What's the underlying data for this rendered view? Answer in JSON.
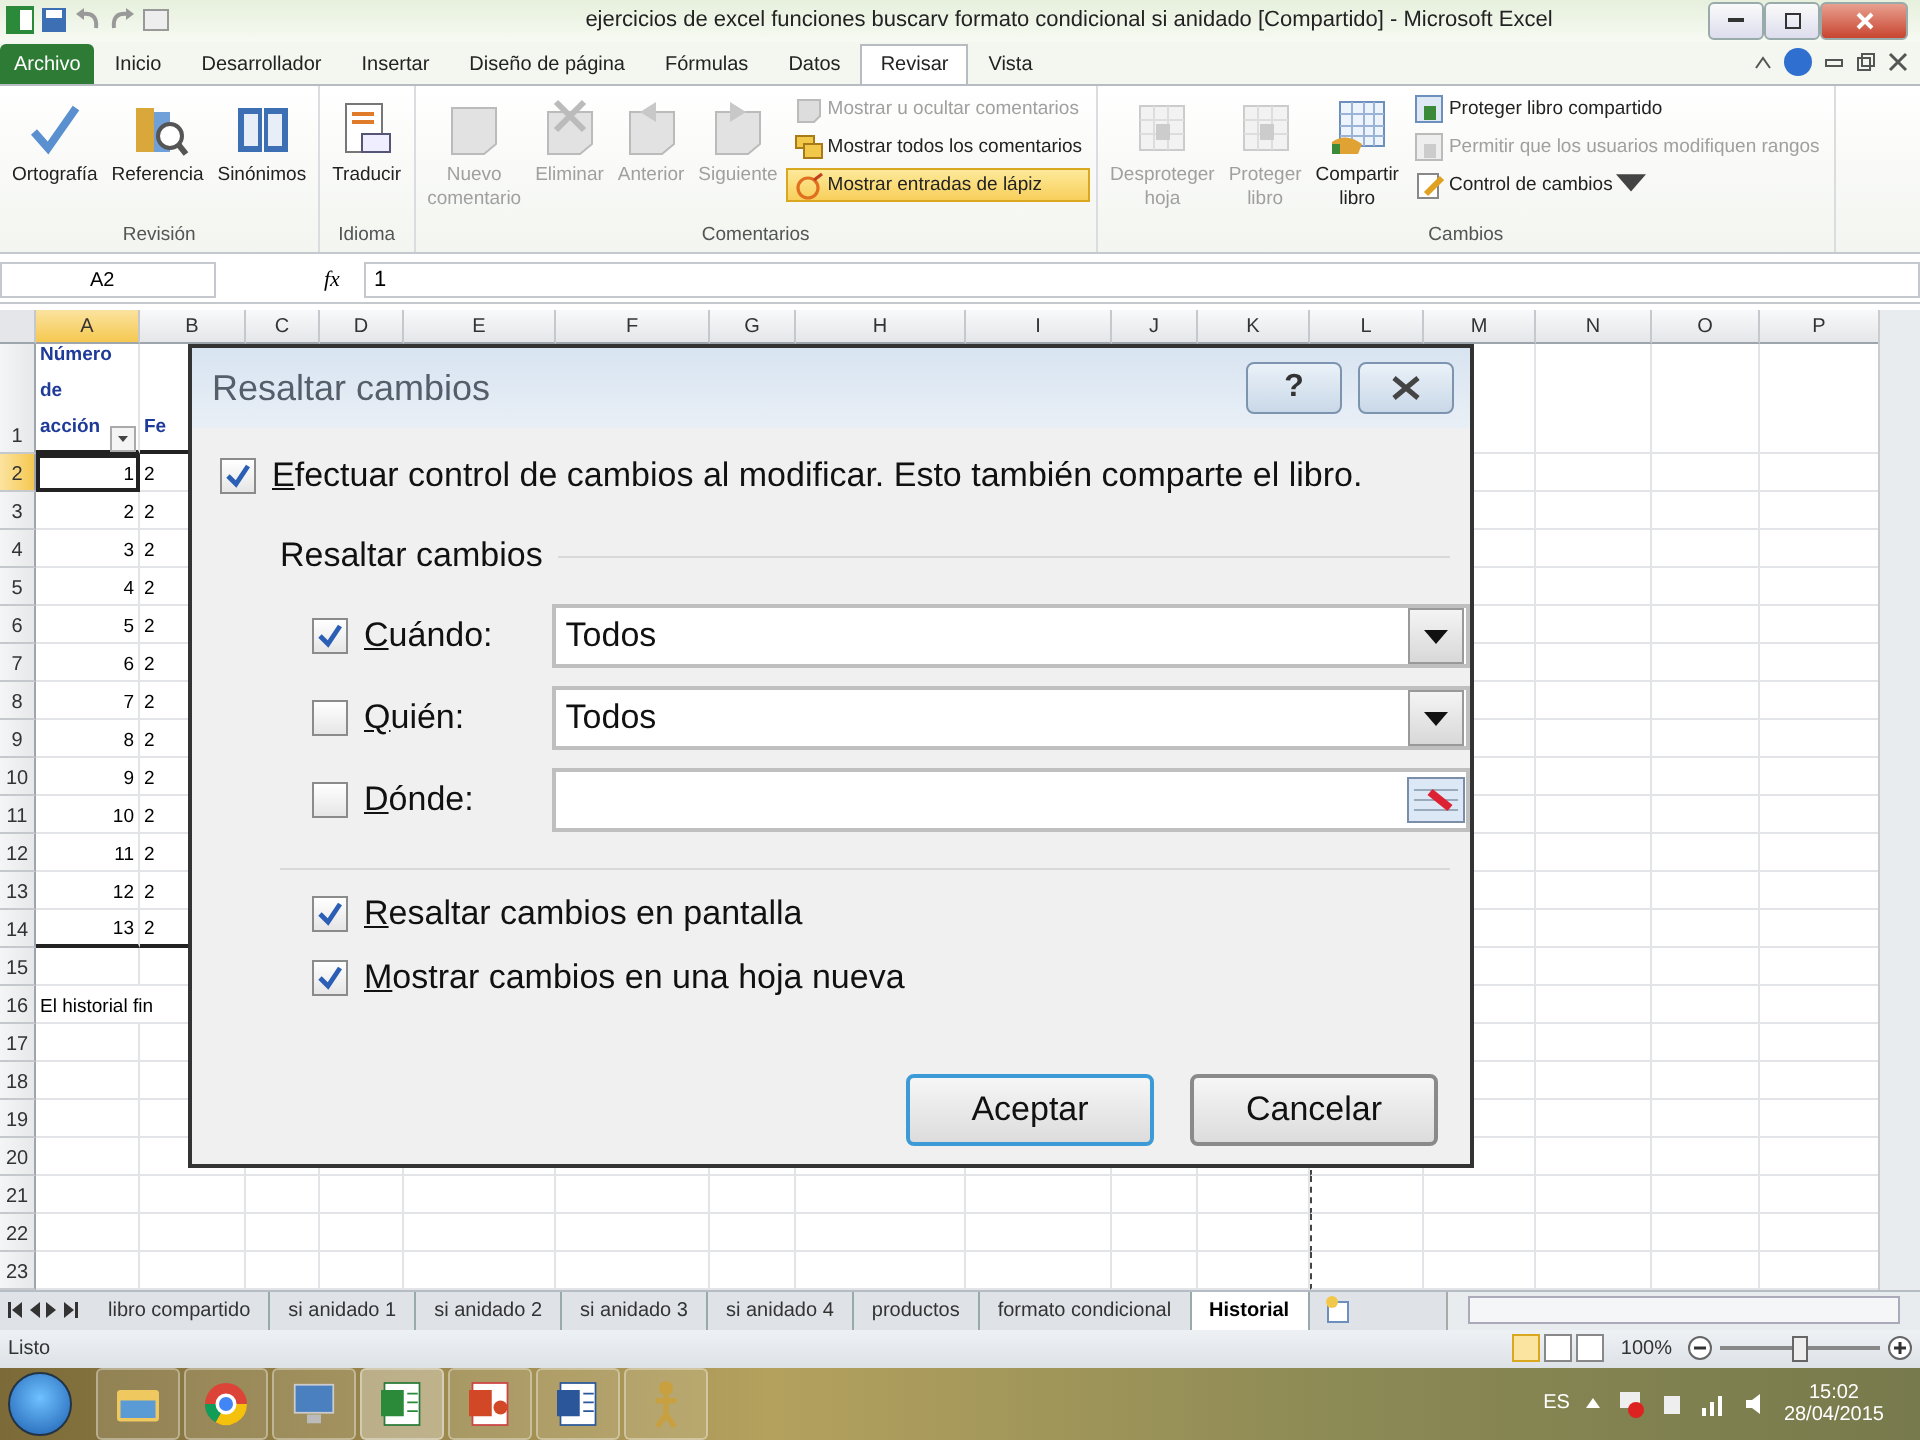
{
  "window": {
    "title": "ejercicios de excel funciones buscarv formato condicional si anidado  [Compartido]  -  Microsoft Excel"
  },
  "tabs": [
    {
      "label": "Archivo",
      "kind": "file",
      "selected": false
    },
    {
      "label": "Inicio",
      "kind": "tab",
      "selected": false
    },
    {
      "label": "Desarrollador",
      "kind": "tab",
      "selected": false
    },
    {
      "label": "Insertar",
      "kind": "tab",
      "selected": false
    },
    {
      "label": "Diseño de página",
      "kind": "tab",
      "selected": false
    },
    {
      "label": "Fórmulas",
      "kind": "tab",
      "selected": false
    },
    {
      "label": "Datos",
      "kind": "tab",
      "selected": false
    },
    {
      "label": "Revisar",
      "kind": "tab",
      "selected": true
    },
    {
      "label": "Vista",
      "kind": "tab",
      "selected": false
    }
  ],
  "ribbon": {
    "groups": [
      {
        "label": "Revisión",
        "items": [
          {
            "kind": "large",
            "label": "Ortografía",
            "disabled": false,
            "on": false
          },
          {
            "kind": "large",
            "label": "Referencia",
            "disabled": false,
            "on": false
          },
          {
            "kind": "large",
            "label": "Sinónimos",
            "disabled": false,
            "on": false
          }
        ]
      },
      {
        "label": "Idioma",
        "items": [
          {
            "kind": "large",
            "label": "Traducir",
            "disabled": false,
            "on": false
          }
        ]
      },
      {
        "label": "Comentarios",
        "items": [
          {
            "kind": "large",
            "label": "Nuevo comentario",
            "disabled": true,
            "on": false
          },
          {
            "kind": "large",
            "label": "Eliminar",
            "disabled": true,
            "on": false
          },
          {
            "kind": "large",
            "label": "Anterior",
            "disabled": true,
            "on": false
          },
          {
            "kind": "large",
            "label": "Siguiente",
            "disabled": true,
            "on": false
          },
          {
            "kind": "small",
            "label": "Mostrar u ocultar comentarios",
            "disabled": true,
            "on": false
          },
          {
            "kind": "small",
            "label": "Mostrar todos los comentarios",
            "disabled": false,
            "on": false
          },
          {
            "kind": "small",
            "label": "Mostrar entradas de lápiz",
            "disabled": false,
            "on": true
          }
        ]
      },
      {
        "label": "Cambios",
        "items": [
          {
            "kind": "large",
            "label": "Desproteger hoja",
            "disabled": true,
            "on": false
          },
          {
            "kind": "large",
            "label": "Proteger libro",
            "disabled": true,
            "on": false
          },
          {
            "kind": "large",
            "label": "Compartir libro",
            "disabled": false,
            "on": false
          },
          {
            "kind": "small",
            "label": "Proteger libro compartido",
            "disabled": false,
            "on": false
          },
          {
            "kind": "small",
            "label": "Permitir que los usuarios modifiquen rangos",
            "disabled": true,
            "on": false
          },
          {
            "kind": "menu",
            "label": "Control de cambios",
            "disabled": false,
            "on": false
          }
        ]
      }
    ]
  },
  "formula_bar": {
    "name_box": "A2",
    "function_label": "fx",
    "formula": "1"
  },
  "sheet": {
    "columns": [
      {
        "label": "A",
        "selected": true
      },
      {
        "label": "B",
        "selected": false
      },
      {
        "label": "C",
        "selected": false
      },
      {
        "label": "D",
        "selected": false
      },
      {
        "label": "E",
        "selected": false
      },
      {
        "label": "F",
        "selected": false
      },
      {
        "label": "G",
        "selected": false
      },
      {
        "label": "H",
        "selected": false
      },
      {
        "label": "I",
        "selected": false
      },
      {
        "label": "J",
        "selected": false
      },
      {
        "label": "K",
        "selected": false
      },
      {
        "label": "L",
        "selected": false
      },
      {
        "label": "M",
        "selected": false
      },
      {
        "label": "N",
        "selected": false
      },
      {
        "label": "O",
        "selected": false
      },
      {
        "label": "P",
        "selected": false
      }
    ],
    "rows": [
      {
        "header": "1",
        "kind": "header",
        "selected": false,
        "cells": [
          {
            "text": "Número de acción",
            "filter": true
          },
          {
            "text": "Fe"
          }
        ]
      },
      {
        "header": "2",
        "kind": "data",
        "selected": true,
        "cells": [
          {
            "text": "1"
          },
          {
            "text": "2"
          }
        ]
      },
      {
        "header": "3",
        "kind": "data",
        "selected": false,
        "cells": [
          {
            "text": "2"
          },
          {
            "text": "2"
          }
        ]
      },
      {
        "header": "4",
        "kind": "data",
        "selected": false,
        "cells": [
          {
            "text": "3"
          },
          {
            "text": "2"
          }
        ]
      },
      {
        "header": "5",
        "kind": "data",
        "selected": false,
        "cells": [
          {
            "text": "4"
          },
          {
            "text": "2"
          }
        ]
      },
      {
        "header": "6",
        "kind": "data",
        "selected": false,
        "cells": [
          {
            "text": "5"
          },
          {
            "text": "2"
          }
        ]
      },
      {
        "header": "7",
        "kind": "data",
        "selected": false,
        "cells": [
          {
            "text": "6"
          },
          {
            "text": "2"
          }
        ]
      },
      {
        "header": "8",
        "kind": "data",
        "selected": false,
        "cells": [
          {
            "text": "7"
          },
          {
            "text": "2"
          }
        ]
      },
      {
        "header": "9",
        "kind": "data",
        "selected": false,
        "cells": [
          {
            "text": "8"
          },
          {
            "text": "2"
          }
        ]
      },
      {
        "header": "10",
        "kind": "data",
        "selected": false,
        "cells": [
          {
            "text": "9"
          },
          {
            "text": "2"
          }
        ]
      },
      {
        "header": "11",
        "kind": "data",
        "selected": false,
        "cells": [
          {
            "text": "10"
          },
          {
            "text": "2"
          }
        ]
      },
      {
        "header": "12",
        "kind": "data",
        "selected": false,
        "cells": [
          {
            "text": "11"
          },
          {
            "text": "2"
          }
        ]
      },
      {
        "header": "13",
        "kind": "data",
        "selected": false,
        "cells": [
          {
            "text": "12"
          },
          {
            "text": "2"
          }
        ]
      },
      {
        "header": "14",
        "kind": "data",
        "selected": false,
        "cells": [
          {
            "text": "13"
          },
          {
            "text": "2"
          }
        ]
      },
      {
        "header": "15",
        "kind": "blank",
        "selected": false,
        "cells": []
      },
      {
        "header": "16",
        "kind": "note",
        "selected": false,
        "cells": [
          {
            "text": "El historial fin"
          }
        ]
      },
      {
        "header": "17",
        "kind": "blank",
        "selected": false,
        "cells": []
      },
      {
        "header": "18",
        "kind": "blank",
        "selected": false,
        "cells": []
      },
      {
        "header": "19",
        "kind": "blank",
        "selected": false,
        "cells": []
      },
      {
        "header": "20",
        "kind": "blank",
        "selected": false,
        "cells": []
      },
      {
        "header": "21",
        "kind": "blank",
        "selected": false,
        "cells": []
      },
      {
        "header": "22",
        "kind": "blank",
        "selected": false,
        "cells": []
      },
      {
        "header": "23",
        "kind": "blank",
        "selected": false,
        "cells": []
      }
    ]
  },
  "dialog": {
    "title": "Resaltar cambios",
    "help": "?",
    "track": {
      "label": "Efectuar control de cambios al modificar. Esto también comparte el libro.",
      "checked": true
    },
    "section": "Resaltar cambios",
    "filters": [
      {
        "label": "Cuándo:",
        "checked": true,
        "kind": "dropdown",
        "value": "Todos"
      },
      {
        "label": "Quién:",
        "checked": false,
        "kind": "dropdown",
        "value": "Todos"
      },
      {
        "label": "Dónde:",
        "checked": false,
        "kind": "range"
      }
    ],
    "options": [
      {
        "label": "Resaltar cambios en pantalla",
        "checked": true
      },
      {
        "label": "Mostrar cambios en una hoja nueva",
        "checked": true
      }
    ],
    "buttons": [
      {
        "label": "Aceptar",
        "default": true
      },
      {
        "label": "Cancelar",
        "default": false
      }
    ]
  },
  "sheet_tabs": [
    {
      "label": "libro compartido",
      "selected": false
    },
    {
      "label": "si anidado 1",
      "selected": false
    },
    {
      "label": "si anidado 2",
      "selected": false
    },
    {
      "label": "si anidado 3",
      "selected": false
    },
    {
      "label": "si anidado 4",
      "selected": false
    },
    {
      "label": "productos",
      "selected": false
    },
    {
      "label": "formato condicional",
      "selected": false
    },
    {
      "label": "Historial",
      "selected": true
    }
  ],
  "status_bar": {
    "status": "Listo",
    "views": [
      {
        "selected": true
      },
      {
        "selected": false
      },
      {
        "selected": false
      }
    ],
    "zoom": "100%",
    "zoom_slider": {
      "level": 0.5
    }
  },
  "taskbar": {
    "apps": [
      {
        "selected": false
      },
      {
        "selected": false
      },
      {
        "selected": false
      },
      {
        "selected": true
      },
      {
        "selected": false
      },
      {
        "selected": false
      },
      {
        "selected": false
      }
    ],
    "language": "ES",
    "time": "15:02",
    "date": "28/04/2015"
  }
}
